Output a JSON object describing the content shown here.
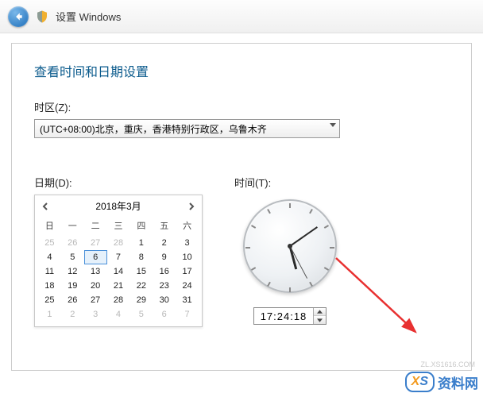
{
  "titlebar": {
    "title": "设置 Windows"
  },
  "heading": "查看时间和日期设置",
  "timezone": {
    "label": "时区(Z):",
    "value": "(UTC+08:00)北京，重庆，香港特别行政区，乌鲁木齐"
  },
  "date": {
    "label": "日期(D):",
    "month_title": "2018年3月",
    "dow": [
      "日",
      "一",
      "二",
      "三",
      "四",
      "五",
      "六"
    ],
    "prev_days": [
      25,
      26,
      27,
      28
    ],
    "days": [
      1,
      2,
      3,
      4,
      5,
      6,
      7,
      8,
      9,
      10,
      11,
      12,
      13,
      14,
      15,
      16,
      17,
      18,
      19,
      20,
      21,
      22,
      23,
      24,
      25,
      26,
      27,
      28,
      29,
      30,
      31
    ],
    "selected": 6,
    "next_days": [
      1,
      2,
      3,
      4,
      5,
      6,
      7
    ]
  },
  "time": {
    "label": "时间(T):",
    "value": "17:24:18"
  },
  "watermark": {
    "badge_x": "X",
    "badge_s": "S",
    "text": "资料网",
    "url": "ZL.XS1616.COM"
  }
}
